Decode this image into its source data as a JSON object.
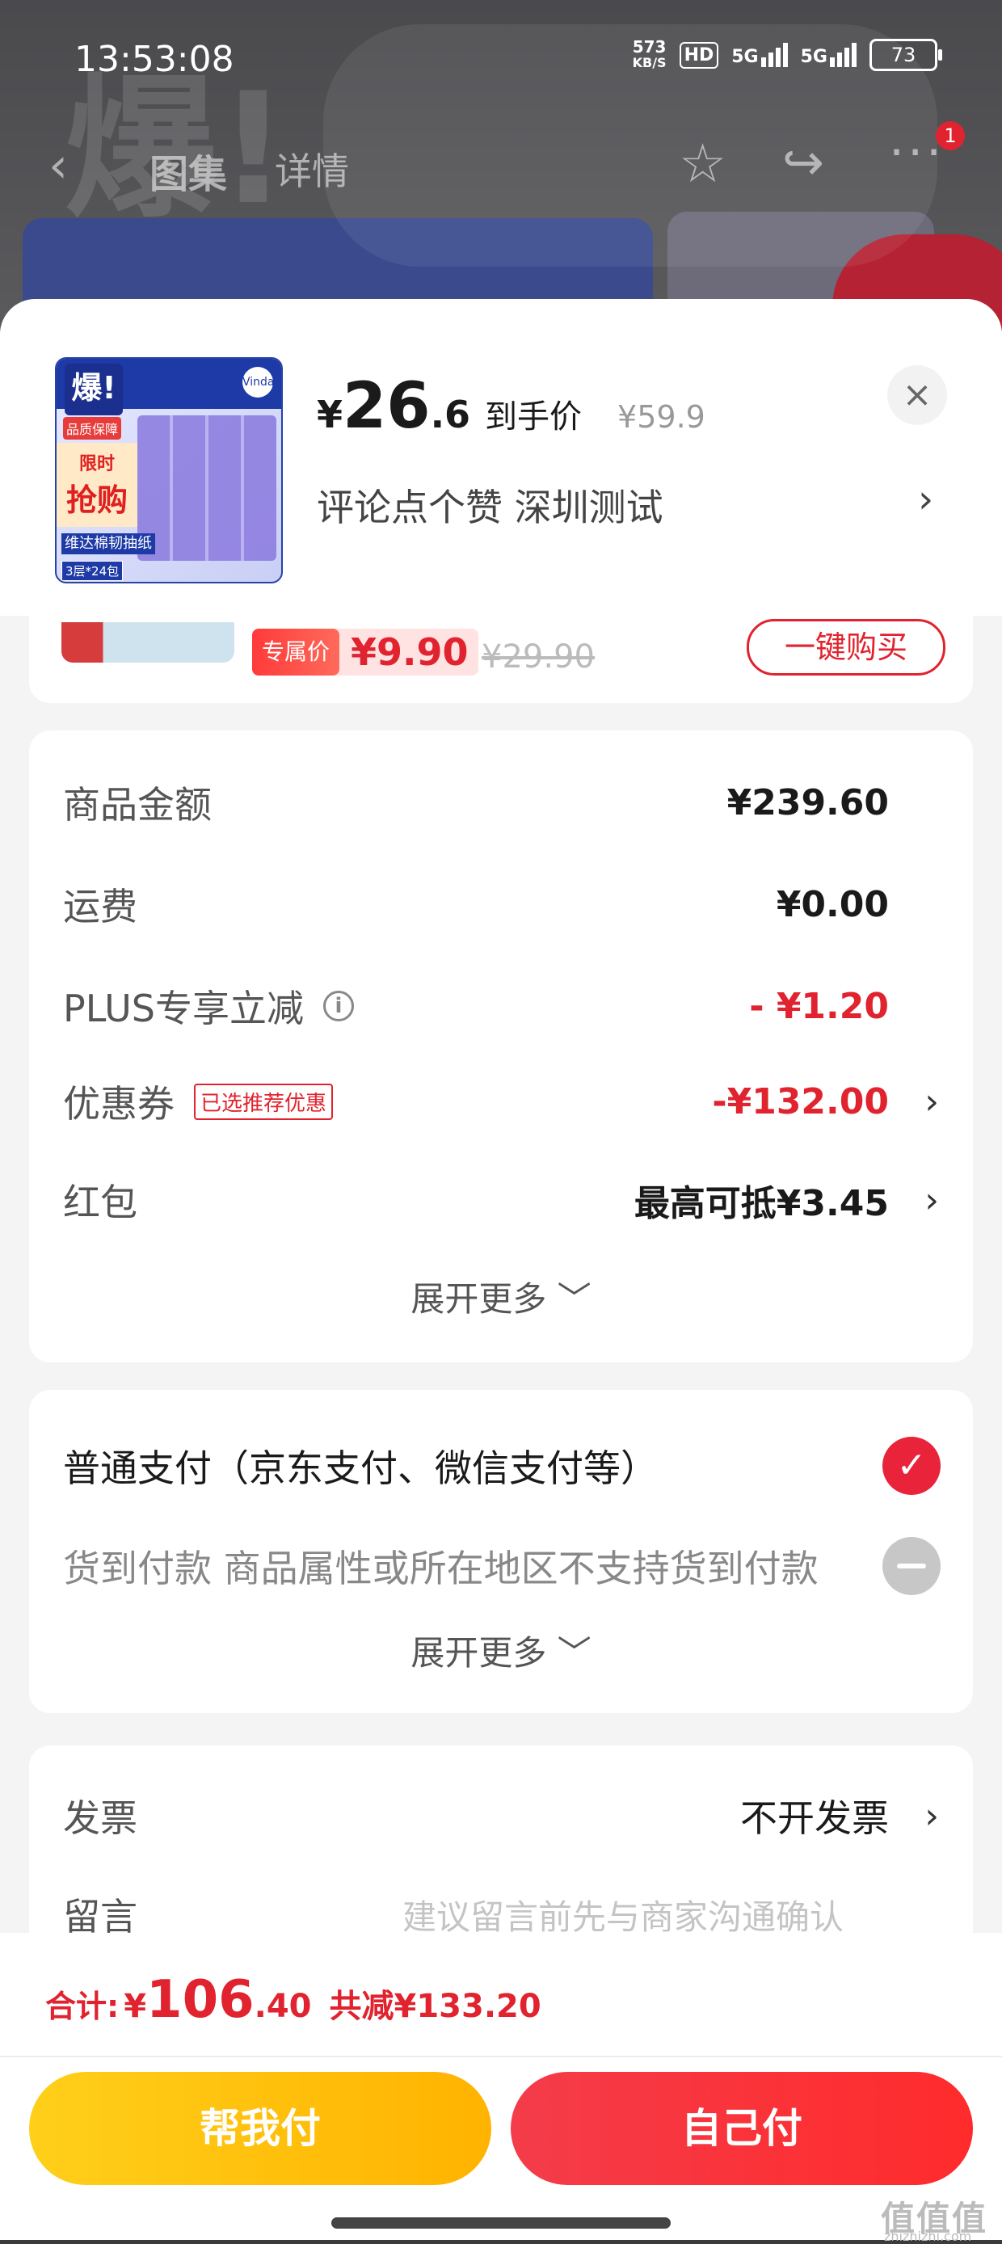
{
  "status_bar": {
    "time": "13:53:08",
    "net_speed_value": "573",
    "net_speed_unit": "KB/S",
    "hd": "HD",
    "signal1": "5G",
    "signal2": "5G",
    "battery": "73"
  },
  "nav": {
    "back_icon": "‹",
    "tab_gallery": "图集",
    "tab_detail": "详情",
    "star_icon": "☆",
    "share_icon": "↪",
    "more_icon": "···",
    "badge": "1"
  },
  "background": {
    "glyph": "爆!"
  },
  "sheet": {
    "thumb": {
      "badge": "爆!",
      "tag": "品质保障",
      "sale_l1": "限时",
      "sale_l2": "抢购",
      "name": "维达棉韧抽纸",
      "spec": "3层*24包",
      "logo": "Vinda"
    },
    "price_symbol": "¥",
    "price_int": "26",
    "price_dec": ".6",
    "price_note": "到手价",
    "price_original": "¥59.9",
    "close_icon": "×",
    "subtitle": "评论点个赞  深圳测试",
    "subtitle_chevron": "›"
  },
  "promo": {
    "tag_label": "专属价",
    "tag_price": "¥9.90",
    "original_price": "¥29.90",
    "button": "一键购买"
  },
  "amounts": {
    "rows": [
      {
        "label": "商品金额",
        "value": "¥239.60"
      },
      {
        "label": "运费",
        "value": "¥0.00"
      },
      {
        "label": "PLUS专享立减",
        "value": "- ¥1.20"
      },
      {
        "label": "优惠券",
        "tag": "已选推荐优惠",
        "value": "-¥132.00"
      },
      {
        "label": "红包",
        "value": "最高可抵¥3.45"
      }
    ],
    "info_icon": "i",
    "chevron": "›",
    "expand": "展开更多 ﹀"
  },
  "payment": {
    "normal": "普通支付（京东支付、微信支付等）",
    "check_icon": "✓",
    "cod": "货到付款  商品属性或所在地区不支持货到付款",
    "expand": "展开更多 ﹀"
  },
  "invoice": {
    "label": "发票",
    "value": "不开发票",
    "chevron": "›",
    "message_label": "留言",
    "message_placeholder": "建议留言前先与商家沟通确认"
  },
  "bottom": {
    "total_label": "合计:",
    "total_symbol": "¥",
    "total_int": "106",
    "total_dec": ".40",
    "discount": "共减¥133.20",
    "help_pay": "帮我付",
    "self_pay": "自己付"
  },
  "watermark": {
    "main": "值值值",
    "sub": "zhizhizhi.com"
  },
  "colors": {
    "accent_red": "#e0232e",
    "help_yellow": "#ffb300",
    "self_red": "#f43c4a"
  }
}
